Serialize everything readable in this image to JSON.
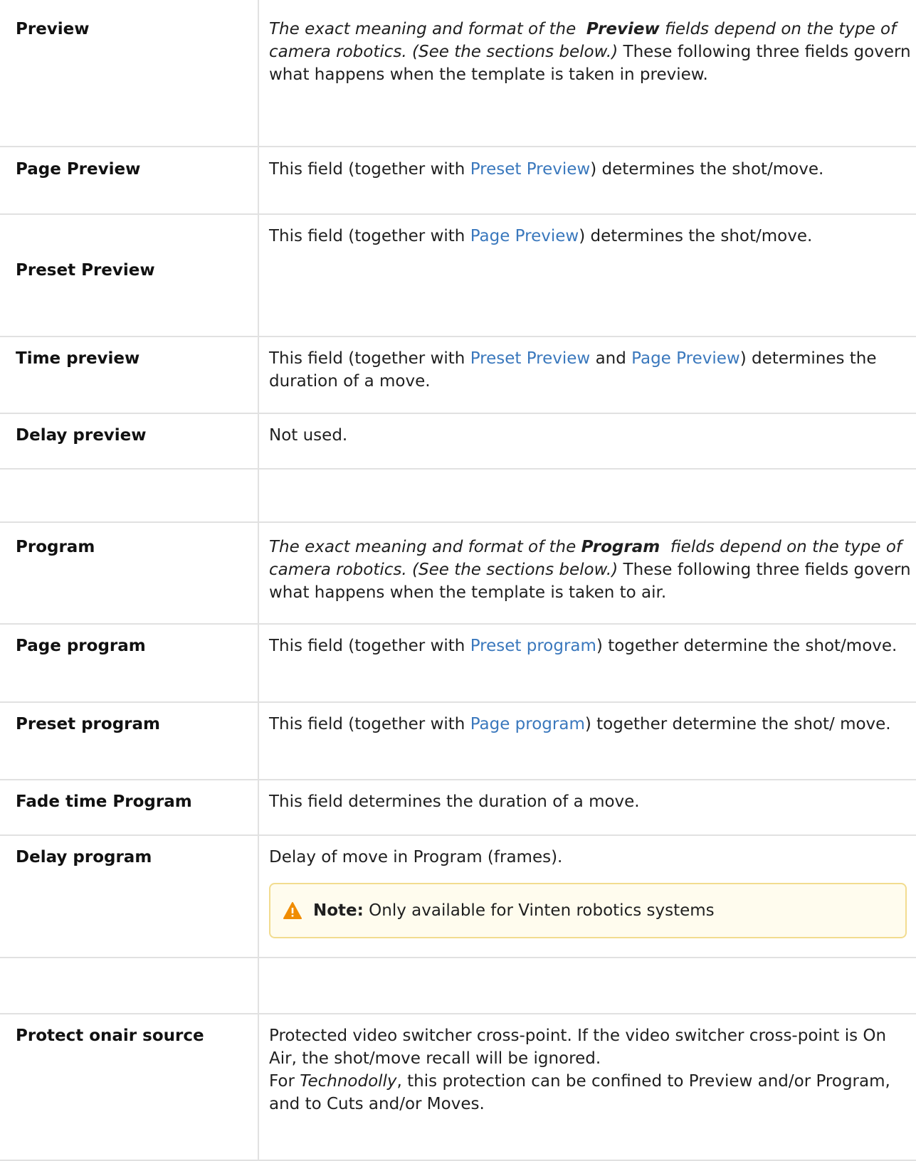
{
  "rows": {
    "preview": {
      "label": "Preview",
      "intro_a": "The exact meaning and format of the",
      "intro_b": "Preview",
      "intro_c": "fields depend on the type of camera robotics. (See the sections below.)",
      "intro_d": "These following three fields govern what happens when the template is taken in preview."
    },
    "page_preview": {
      "label": "Page Preview",
      "a": "This field (together with",
      "link": "Preset Preview",
      "b": ") determines the shot/move."
    },
    "preset_preview": {
      "label": "Preset Preview",
      "a": "This field (together with",
      "link": "Page Preview",
      "b": ") determines the shot/move."
    },
    "time_preview": {
      "label": "Time preview",
      "a": "This field (together with",
      "link1": "Preset Preview",
      "mid": "and",
      "link2": "Page Preview",
      "b": ") determines the duration of a move."
    },
    "delay_preview": {
      "label": "Delay preview",
      "desc": "Not used."
    },
    "program": {
      "label": "Program",
      "intro_a": "The exact meaning and format of the",
      "intro_b": "Program",
      "intro_c": "fields depend on the type of camera robotics. (See the sections below.)",
      "intro_d": "These following three fields govern what happens when the template is taken to air."
    },
    "page_program": {
      "label": "Page program",
      "a": "This field (together with",
      "link": "Preset program",
      "b": ") together determine the shot/move."
    },
    "preset_program": {
      "label": "Preset program",
      "a": "This field (together with",
      "link": "Page program",
      "b": ") together determine the shot/ move."
    },
    "fade_time_program": {
      "label": "Fade time Program",
      "desc": "This field determines the duration of a move."
    },
    "delay_program": {
      "label": "Delay program",
      "desc": "Delay of move in Program (frames).",
      "note_label": "Note:",
      "note_text": "Only available for Vinten robotics systems",
      "note_icon": "warning-icon",
      "note_icon_color": "#f08c00"
    },
    "protect_onair": {
      "label": "Protect onair source",
      "line1": "Protected video switcher cross-point. If the video switcher cross-point is On Air, the shot/move recall will be ignored.",
      "line2a": "For",
      "line2b": "Technodolly",
      "line2c": ", this protection can be confined to Preview and/or Program, and to Cuts and/or Moves."
    }
  },
  "colors": {
    "link": "#3a78bd",
    "border": "#e1e1e1",
    "note_border": "#f2dc8f",
    "note_bg": "#fffcee"
  }
}
